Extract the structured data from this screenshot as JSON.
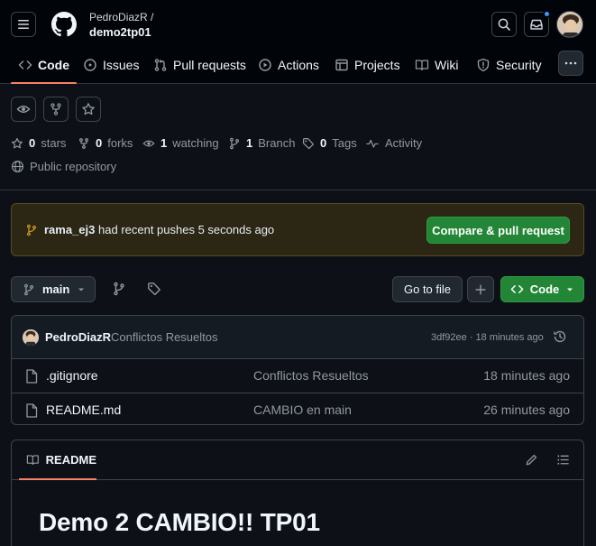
{
  "header": {
    "owner": "PedroDiazR /",
    "repo": "demo2tp01"
  },
  "nav": {
    "tabs": [
      {
        "label": "Code",
        "icon": "code-icon",
        "selected": true
      },
      {
        "label": "Issues",
        "icon": "issue-icon"
      },
      {
        "label": "Pull requests",
        "icon": "pull-request-icon"
      },
      {
        "label": "Actions",
        "icon": "play-icon"
      },
      {
        "label": "Projects",
        "icon": "table-icon"
      },
      {
        "label": "Wiki",
        "icon": "book-icon"
      },
      {
        "label": "Security",
        "icon": "shield-icon"
      }
    ]
  },
  "repo_stats": {
    "stars_count": "0",
    "stars_label": "stars",
    "forks_count": "0",
    "forks_label": "forks",
    "watching_count": "1",
    "watching_label": "watching",
    "branch_count": "1",
    "branch_label": "Branch",
    "tags_count": "0",
    "tags_label": "Tags",
    "activity_label": "Activity",
    "visibility": "Public repository"
  },
  "push_banner": {
    "branch": "rama_ej3",
    "message": "had recent pushes 5 seconds ago",
    "button": "Compare & pull request"
  },
  "toolbar": {
    "branch": "main",
    "go_to_file": "Go to file",
    "code_button": "Code"
  },
  "latest_commit": {
    "author": "PedroDiazR",
    "message": "Conflictos Resueltos",
    "meta": "3df92ee · 18 minutes ago"
  },
  "files": [
    {
      "name": ".gitignore",
      "message": "Conflictos Resueltos",
      "time": "18 minutes ago"
    },
    {
      "name": "README.md",
      "message": "CAMBIO en main",
      "time": "26 minutes ago"
    }
  ],
  "readme": {
    "tab_label": "README",
    "heading": "Demo 2 CAMBIO!! TP01"
  },
  "colors": {
    "accent_underline": "#f78166",
    "green_button": "#238636",
    "notification_dot": "#4493f8"
  }
}
